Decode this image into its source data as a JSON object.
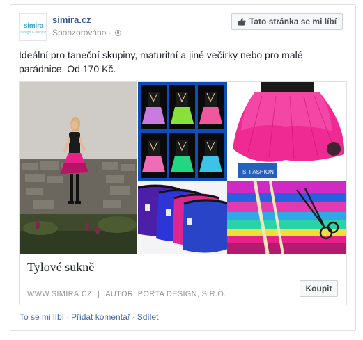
{
  "post": {
    "page_name": "simira.cz",
    "sponsored_label": "Sponzorováno",
    "sponsored_separator": "·",
    "avatar": {
      "logo_text": "simira",
      "logo_subtext": "design & fashion"
    },
    "like_page_button": {
      "label": "Tato stránka se mi líbí",
      "icon": "thumbs-up-icon"
    },
    "privacy_icon": "globe-icon",
    "text": "Ideální pro taneční skupiny, maturitní a jiné večírky nebo pro malé parádnice. Od 170 Kč."
  },
  "link": {
    "image_watermark": "SI FASHION",
    "title": "Tylové sukně",
    "domain": "WWW.SIMIRA.CZ",
    "separator": "|",
    "author": "AUTOR: PORTA DESIGN, S.R.O.",
    "cta_label": "Koupit"
  },
  "actions": {
    "like": "To se mi líbí",
    "comment": "Přidat komentář",
    "share": "Sdílet",
    "separator": "·"
  },
  "colors": {
    "link_blue": "#365899",
    "action_blue": "#4267b2",
    "muted_gray": "#90949c",
    "skirt_pink": "#e8208a",
    "border": "#dddfe2"
  }
}
